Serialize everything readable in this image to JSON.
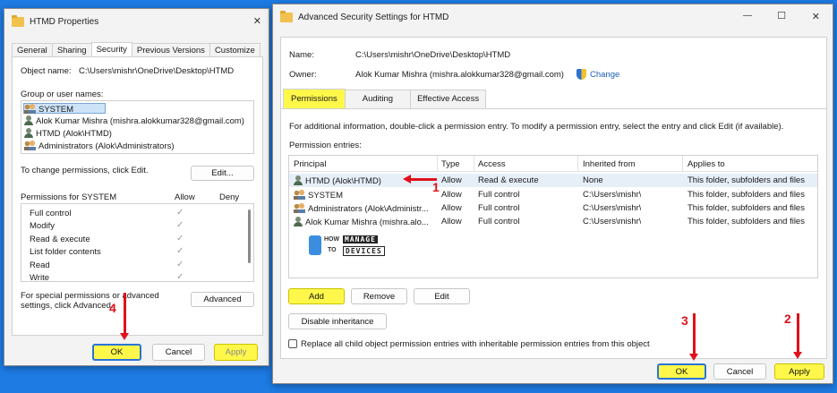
{
  "props": {
    "title": "HTMD Properties",
    "close": "✕",
    "tabs": [
      "General",
      "Sharing",
      "Security",
      "Previous Versions",
      "Customize"
    ],
    "object_label": "Object name:",
    "object_value": "C:\\Users\\mishr\\OneDrive\\Desktop\\HTMD",
    "group_label": "Group or user names:",
    "users": [
      "SYSTEM",
      "Alok Kumar Mishra (mishra.alokkumar328@gmail.com)",
      "HTMD (Alok\\HTMD)",
      "Administrators (Alok\\Administrators)"
    ],
    "change_text": "To change permissions, click Edit.",
    "edit_label": "Edit...",
    "perms_for": "Permissions for SYSTEM",
    "allow_col": "Allow",
    "deny_col": "Deny",
    "perms": [
      "Full control",
      "Modify",
      "Read & execute",
      "List folder contents",
      "Read",
      "Write"
    ],
    "special_text": "For special permissions or advanced settings, click Advanced.",
    "advanced_label": "Advanced",
    "ok_label": "OK",
    "cancel_label": "Cancel",
    "apply_label": "Apply"
  },
  "adv": {
    "title": "Advanced Security Settings for HTMD",
    "minimize": "—",
    "maximize": "☐",
    "close": "✕",
    "name_label": "Name:",
    "name_value": "C:\\Users\\mishr\\OneDrive\\Desktop\\HTMD",
    "owner_label": "Owner:",
    "owner_value": "Alok Kumar Mishra (mishra.alokkumar328@gmail.com)",
    "change_label": "Change",
    "tabs": [
      "Permissions",
      "Auditing",
      "Effective Access"
    ],
    "info_text": "For additional information, double-click a permission entry. To modify a permission entry, select the entry and click Edit (if available).",
    "entries_label": "Permission entries:",
    "columns": [
      "Principal",
      "Type",
      "Access",
      "Inherited from",
      "Applies to"
    ],
    "rows": [
      {
        "principal": "HTMD (Alok\\HTMD)",
        "type": "Allow",
        "access": "Read & execute",
        "inherited": "None",
        "applies": "This folder, subfolders and files"
      },
      {
        "principal": "SYSTEM",
        "type": "Allow",
        "access": "Full control",
        "inherited": "C:\\Users\\mishr\\",
        "applies": "This folder, subfolders and files"
      },
      {
        "principal": "Administrators (Alok\\Administr...",
        "type": "Allow",
        "access": "Full control",
        "inherited": "C:\\Users\\mishr\\",
        "applies": "This folder, subfolders and files"
      },
      {
        "principal": "Alok Kumar Mishra (mishra.alo...",
        "type": "Allow",
        "access": "Full control",
        "inherited": "C:\\Users\\mishr\\",
        "applies": "This folder, subfolders and files"
      }
    ],
    "add_label": "Add",
    "remove_label": "Remove",
    "edit_label": "Edit",
    "disable_label": "Disable inheritance",
    "replace_text": "Replace all child object permission entries with inheritable permission entries from this object",
    "ok_label": "OK",
    "cancel_label": "Cancel",
    "apply_label": "Apply"
  },
  "watermark": {
    "how": "HOW",
    "to": "TO",
    "manage": "MANAGE",
    "devices": "DEVICES"
  },
  "annotations": {
    "n1": "1",
    "n2": "2",
    "n3": "3",
    "n4": "4"
  }
}
